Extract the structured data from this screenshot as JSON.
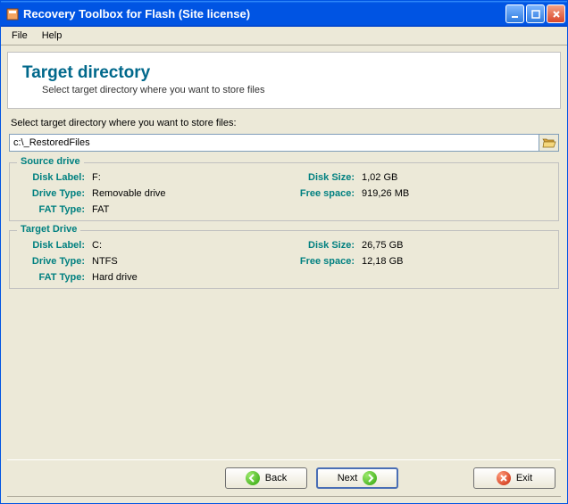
{
  "titlebar": {
    "title": "Recovery Toolbox for Flash (Site license)"
  },
  "menu": {
    "file": "File",
    "help": "Help"
  },
  "header": {
    "title": "Target directory",
    "subtitle": "Select target directory where you want to store files"
  },
  "body": {
    "prompt": "Select target directory where you want to store files:",
    "path_value": "c:\\_RestoredFiles"
  },
  "source": {
    "legend": "Source drive",
    "disk_label_lbl": "Disk Label:",
    "disk_label_val": "F:",
    "drive_type_lbl": "Drive Type:",
    "drive_type_val": "Removable drive",
    "fat_type_lbl": "FAT Type:",
    "fat_type_val": "FAT",
    "disk_size_lbl": "Disk Size:",
    "disk_size_val": "1,02 GB",
    "free_space_lbl": "Free space:",
    "free_space_val": "919,26 MB"
  },
  "target": {
    "legend": "Target Drive",
    "disk_label_lbl": "Disk Label:",
    "disk_label_val": "C:",
    "drive_type_lbl": "Drive Type:",
    "drive_type_val": "NTFS",
    "fat_type_lbl": "FAT Type:",
    "fat_type_val": "Hard drive",
    "disk_size_lbl": "Disk Size:",
    "disk_size_val": "26,75 GB",
    "free_space_lbl": "Free space:",
    "free_space_val": "12,18 GB"
  },
  "buttons": {
    "back": "Back",
    "next": "Next",
    "exit": "Exit"
  }
}
